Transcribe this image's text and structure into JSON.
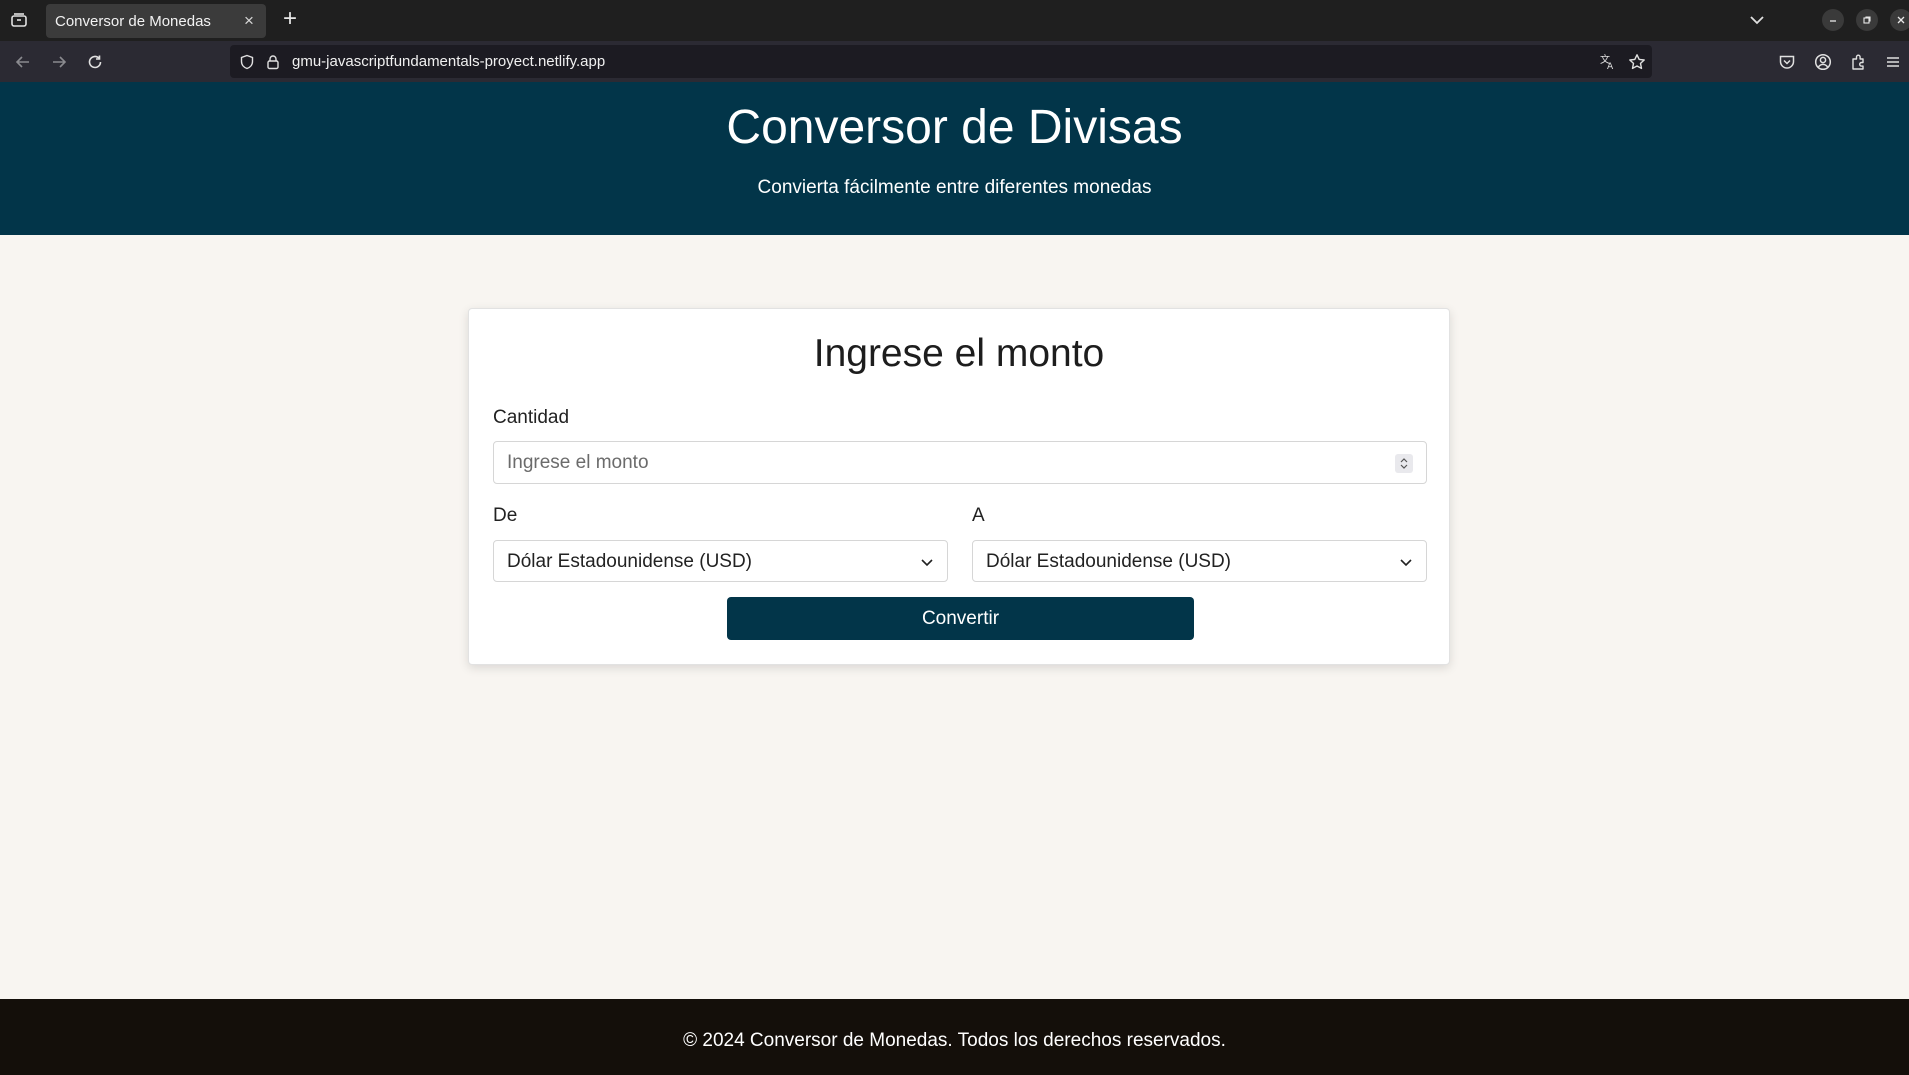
{
  "browser": {
    "tab_title": "Conversor de Monedas",
    "tab_close": "×",
    "new_tab": "+",
    "url": "gmu-javascriptfundamentals-proyect.netlify.app",
    "icons": [
      "tab-list-icon",
      "close-icon",
      "plus-icon",
      "chevron-down-icon",
      "minimize-icon",
      "restore-icon",
      "close-window-icon",
      "back-icon",
      "forward-icon",
      "reload-icon",
      "shield-icon",
      "lock-icon",
      "translate-icon",
      "star-icon",
      "pocket-icon",
      "account-icon",
      "extensions-icon",
      "menu-icon"
    ]
  },
  "header": {
    "title": "Conversor de Divisas",
    "subtitle": "Convierta fácilmente entre diferentes monedas"
  },
  "form": {
    "title": "Ingrese el monto",
    "amount_label": "Cantidad",
    "amount_placeholder": "Ingrese el monto",
    "amount_value": "",
    "from_label": "De",
    "from_value": "Dólar Estadounidense (USD)",
    "to_label": "A",
    "to_value": "Dólar Estadounidense (USD)",
    "convert_label": "Convertir"
  },
  "footer": {
    "text": "© 2024 Conversor de Monedas. Todos los derechos reservados."
  },
  "colors": {
    "header_bg": "#023549",
    "button_bg": "#023549",
    "page_bg": "#f8f5f1",
    "footer_bg": "#140f0a"
  }
}
